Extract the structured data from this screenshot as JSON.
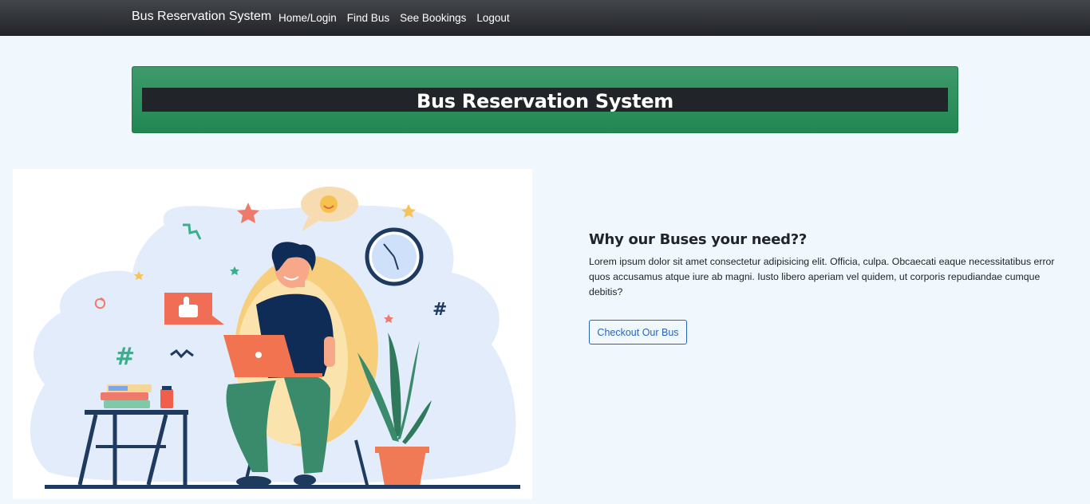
{
  "navbar": {
    "brand": "Bus Reservation System",
    "links": [
      "Home/Login",
      "Find Bus",
      "See Bookings",
      "Logout"
    ]
  },
  "hero": {
    "title": "Bus Reservation System"
  },
  "info": {
    "heading": "Why our Buses your need??",
    "text": "Lorem ipsum dolor sit amet consectetur adipisicing elit. Officia, culpa. Obcaecati eaque necessitatibus error quos accusamus atque iure ab magni. Iusto libero aperiam vel quidem, ut corporis repudiandae cumque debitis?",
    "button_label": "Checkout Our Bus"
  },
  "colors": {
    "navbar": "#2b2d31",
    "hero_green": "#2e8f5e",
    "hero_bar": "#212529",
    "page_bg": "#f0f7fd",
    "button_blue": "#2a64b8"
  }
}
